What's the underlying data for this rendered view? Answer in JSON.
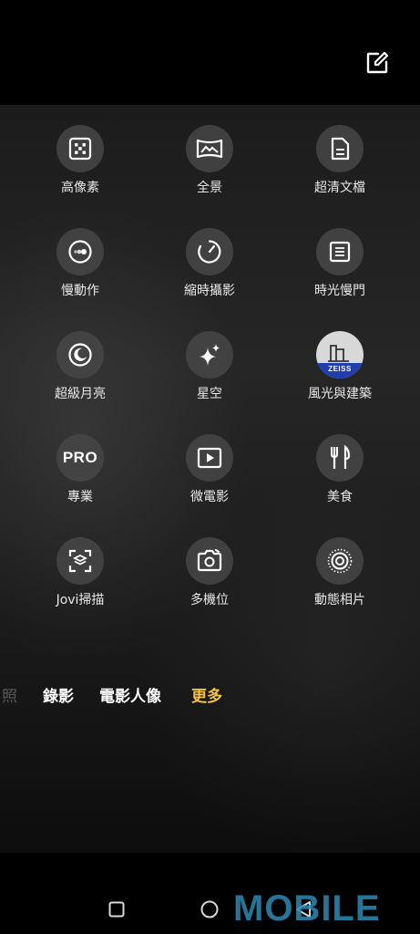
{
  "top": {
    "edit_icon": "edit-square-icon"
  },
  "modes_grid": [
    [
      {
        "label": "高像素",
        "icon": "high-pixel-icon"
      },
      {
        "label": "全景",
        "icon": "panorama-icon"
      },
      {
        "label": "超清文檔",
        "icon": "document-icon"
      }
    ],
    [
      {
        "label": "慢動作",
        "icon": "slow-motion-icon"
      },
      {
        "label": "縮時攝影",
        "icon": "timelapse-icon"
      },
      {
        "label": "時光慢門",
        "icon": "slow-shutter-icon"
      }
    ],
    [
      {
        "label": "超級月亮",
        "icon": "moon-icon"
      },
      {
        "label": "星空",
        "icon": "starry-sky-icon"
      },
      {
        "label": "風光與建築",
        "icon": "zeiss-landscape-icon",
        "badge": "ZEISS"
      }
    ],
    [
      {
        "label": "專業",
        "icon": "pro-icon",
        "icon_text": "PRO"
      },
      {
        "label": "微電影",
        "icon": "micro-movie-icon"
      },
      {
        "label": "美食",
        "icon": "food-icon"
      }
    ],
    [
      {
        "label": "Jovi掃描",
        "icon": "jovi-scan-icon"
      },
      {
        "label": "多機位",
        "icon": "multi-camera-icon"
      },
      {
        "label": "動態相片",
        "icon": "live-photo-icon"
      }
    ]
  ],
  "mode_bar": {
    "partial": "照",
    "items": [
      "錄影",
      "電影人像"
    ],
    "active": "更多"
  },
  "navbar": {
    "recent": "square-icon",
    "home": "circle-icon",
    "back": "triangle-back-icon"
  },
  "watermark": "MOBILE",
  "colors": {
    "accent": "#f5c242",
    "icon_bg": "#464646",
    "zeiss_blue": "#1f3fb0",
    "watermark": "#2b8bb4"
  }
}
